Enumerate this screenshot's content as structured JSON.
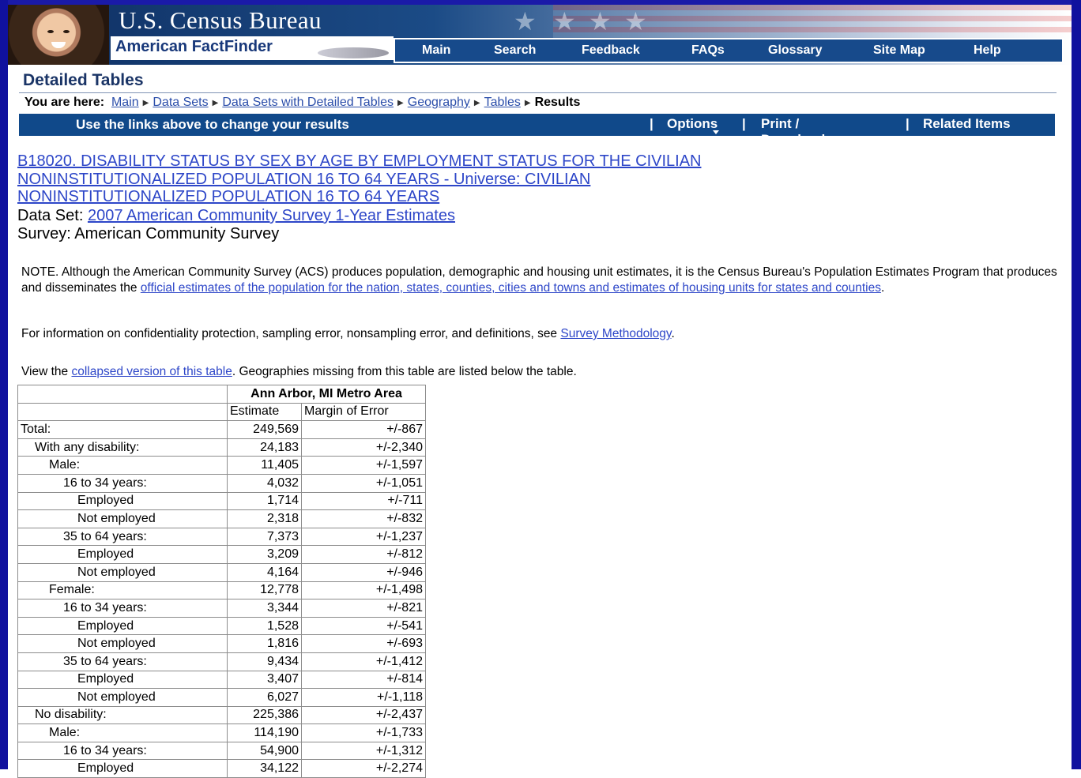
{
  "header": {
    "brand_title": "U.S. Census Bureau",
    "product": "American FactFinder",
    "nav": [
      "Main",
      "Search",
      "Feedback",
      "FAQs",
      "Glossary",
      "Site Map",
      "Help"
    ]
  },
  "page": {
    "title": "Detailed Tables",
    "breadcrumb_prefix": "You are here:",
    "breadcrumbs": [
      "Main",
      "Data Sets",
      "Data Sets with Detailed Tables",
      "Geography",
      "Tables"
    ],
    "breadcrumb_current": "Results"
  },
  "options_bar": {
    "message": "Use the links above to change your results",
    "options": "Options",
    "print": "Print / Download",
    "related": "Related Items"
  },
  "table_info": {
    "title_line1": "B18020. DISABILITY STATUS BY SEX BY AGE BY EMPLOYMENT STATUS FOR THE CIVILIAN",
    "title_line2": "NONINSTITUTIONALIZED POPULATION 16 TO 64 YEARS - Universe: CIVILIAN",
    "title_line3": "NONINSTITUTIONALIZED POPULATION 16 TO 64 YEARS",
    "dataset_label": "Data Set:",
    "dataset_link": "2007 American Community Survey 1-Year Estimates",
    "survey": "Survey: American Community Survey"
  },
  "notes": {
    "note_text": "NOTE. Although the American Community Survey (ACS) produces population, demographic and housing unit estimates, it is the Census Bureau's Population Estimates Program that produces and disseminates the ",
    "note_link": "official estimates of the population for the nation, states, counties, cities and towns and estimates of housing units for states and counties",
    "note_end": ".",
    "info_text": "For information on confidentiality protection, sampling error, nonsampling error, and definitions, see ",
    "info_link": "Survey Methodology",
    "info_end": ".",
    "view_text": "View the ",
    "view_link": "collapsed version of this table",
    "view_end": ".  Geographies missing from this table are listed below the table."
  },
  "data_table": {
    "geography": "Ann Arbor, MI Metro Area",
    "col_estimate": "Estimate",
    "col_moe": "Margin of Error",
    "rows": [
      {
        "label": "Total:",
        "indent": 0,
        "estimate": "249,569",
        "moe": "+/-867"
      },
      {
        "label": "With any disability:",
        "indent": 1,
        "estimate": "24,183",
        "moe": "+/-2,340"
      },
      {
        "label": "Male:",
        "indent": 2,
        "estimate": "11,405",
        "moe": "+/-1,597"
      },
      {
        "label": "16 to 34 years:",
        "indent": 3,
        "estimate": "4,032",
        "moe": "+/-1,051"
      },
      {
        "label": "Employed",
        "indent": 4,
        "estimate": "1,714",
        "moe": "+/-711"
      },
      {
        "label": "Not employed",
        "indent": 4,
        "estimate": "2,318",
        "moe": "+/-832"
      },
      {
        "label": "35 to 64 years:",
        "indent": 3,
        "estimate": "7,373",
        "moe": "+/-1,237"
      },
      {
        "label": "Employed",
        "indent": 4,
        "estimate": "3,209",
        "moe": "+/-812"
      },
      {
        "label": "Not employed",
        "indent": 4,
        "estimate": "4,164",
        "moe": "+/-946"
      },
      {
        "label": "Female:",
        "indent": 2,
        "estimate": "12,778",
        "moe": "+/-1,498"
      },
      {
        "label": "16 to 34 years:",
        "indent": 3,
        "estimate": "3,344",
        "moe": "+/-821"
      },
      {
        "label": "Employed",
        "indent": 4,
        "estimate": "1,528",
        "moe": "+/-541"
      },
      {
        "label": "Not employed",
        "indent": 4,
        "estimate": "1,816",
        "moe": "+/-693"
      },
      {
        "label": "35 to 64 years:",
        "indent": 3,
        "estimate": "9,434",
        "moe": "+/-1,412"
      },
      {
        "label": "Employed",
        "indent": 4,
        "estimate": "3,407",
        "moe": "+/-814"
      },
      {
        "label": "Not employed",
        "indent": 4,
        "estimate": "6,027",
        "moe": "+/-1,118"
      },
      {
        "label": "No disability:",
        "indent": 1,
        "estimate": "225,386",
        "moe": "+/-2,437"
      },
      {
        "label": "Male:",
        "indent": 2,
        "estimate": "114,190",
        "moe": "+/-1,733"
      },
      {
        "label": "16 to 34 years:",
        "indent": 3,
        "estimate": "54,900",
        "moe": "+/-1,312"
      },
      {
        "label": "Employed",
        "indent": 4,
        "estimate": "34,122",
        "moe": "+/-2,274"
      }
    ]
  }
}
